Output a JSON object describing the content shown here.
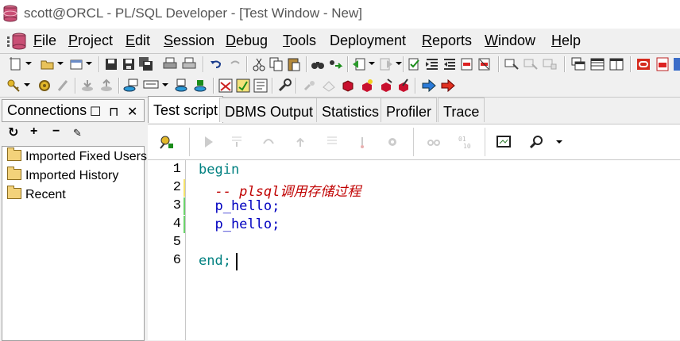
{
  "window": {
    "title": "scott@ORCL - PL/SQL Developer - [Test Window - New]"
  },
  "menu": {
    "items": [
      {
        "label": "File",
        "mnemonic": "F",
        "rest": "ile"
      },
      {
        "label": "Project",
        "mnemonic": "P",
        "rest": "roject"
      },
      {
        "label": "Edit",
        "mnemonic": "E",
        "rest": "dit"
      },
      {
        "label": "Session",
        "mnemonic": "S",
        "rest": "ession"
      },
      {
        "label": "Debug",
        "mnemonic": "D",
        "rest": "ebug"
      },
      {
        "label": "Tools",
        "mnemonic": "T",
        "rest": "ools"
      },
      {
        "label": "Deployment",
        "mnemonic": "",
        "rest": "Deployment"
      },
      {
        "label": "Reports",
        "mnemonic": "R",
        "rest": "eports"
      },
      {
        "label": "Window",
        "mnemonic": "W",
        "rest": "indow"
      },
      {
        "label": "Help",
        "mnemonic": "H",
        "rest": "elp"
      }
    ]
  },
  "connections": {
    "title": "Connections",
    "tree": [
      {
        "label": "Imported Fixed Users"
      },
      {
        "label": "Imported History"
      },
      {
        "label": "Recent"
      }
    ]
  },
  "tabs": [
    {
      "label": "Test script",
      "active": true
    },
    {
      "label": "DBMS Output",
      "active": false
    },
    {
      "label": "Statistics",
      "active": false
    },
    {
      "label": "Profiler",
      "active": false
    },
    {
      "label": "Trace",
      "active": false
    }
  ],
  "editor": {
    "line_numbers": [
      "1",
      "2",
      "3",
      "4",
      "5",
      "6"
    ],
    "lines": [
      {
        "text": "begin",
        "kind": "keyword"
      },
      {
        "text": "  -- plsql调用存储过程",
        "kind": "comment"
      },
      {
        "text": "  p_hello;",
        "kind": "code"
      },
      {
        "text": "  p_hello;",
        "kind": "code"
      },
      {
        "text": "",
        "kind": "code"
      },
      {
        "text": "end;",
        "kind": "keyword"
      }
    ]
  },
  "colors": {
    "keyword": "#008080",
    "comment": "#c00000",
    "changed_line_marker": "#f5e36a",
    "saved_line_marker": "#6cd46c"
  }
}
